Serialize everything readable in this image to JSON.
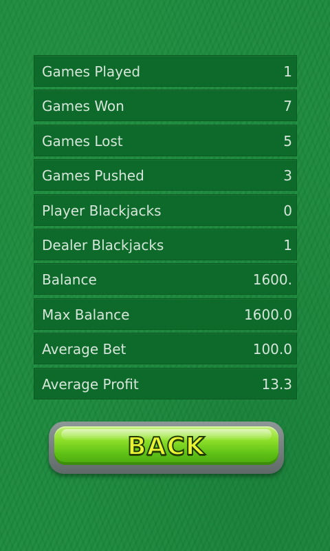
{
  "stats": {
    "rows": [
      {
        "label": "Games Played",
        "value": "1"
      },
      {
        "label": "Games Won",
        "value": "7"
      },
      {
        "label": "Games Lost",
        "value": "5"
      },
      {
        "label": "Games Pushed",
        "value": "3"
      },
      {
        "label": "Player Blackjacks",
        "value": "0"
      },
      {
        "label": "Dealer Blackjacks",
        "value": "1"
      },
      {
        "label": "Balance",
        "value": "1600."
      },
      {
        "label": "Max Balance",
        "value": "1600.0"
      },
      {
        "label": "Average Bet",
        "value": "100.0"
      },
      {
        "label": "Average Profit",
        "value": "13.3"
      }
    ]
  },
  "back_button": {
    "label": "BACK"
  },
  "colors": {
    "background": "#1b8a3c",
    "row_background": "#0d6a2a",
    "row_text": "#d7e6da",
    "button_green": "#8fe02a",
    "button_text": "#e9f534"
  }
}
